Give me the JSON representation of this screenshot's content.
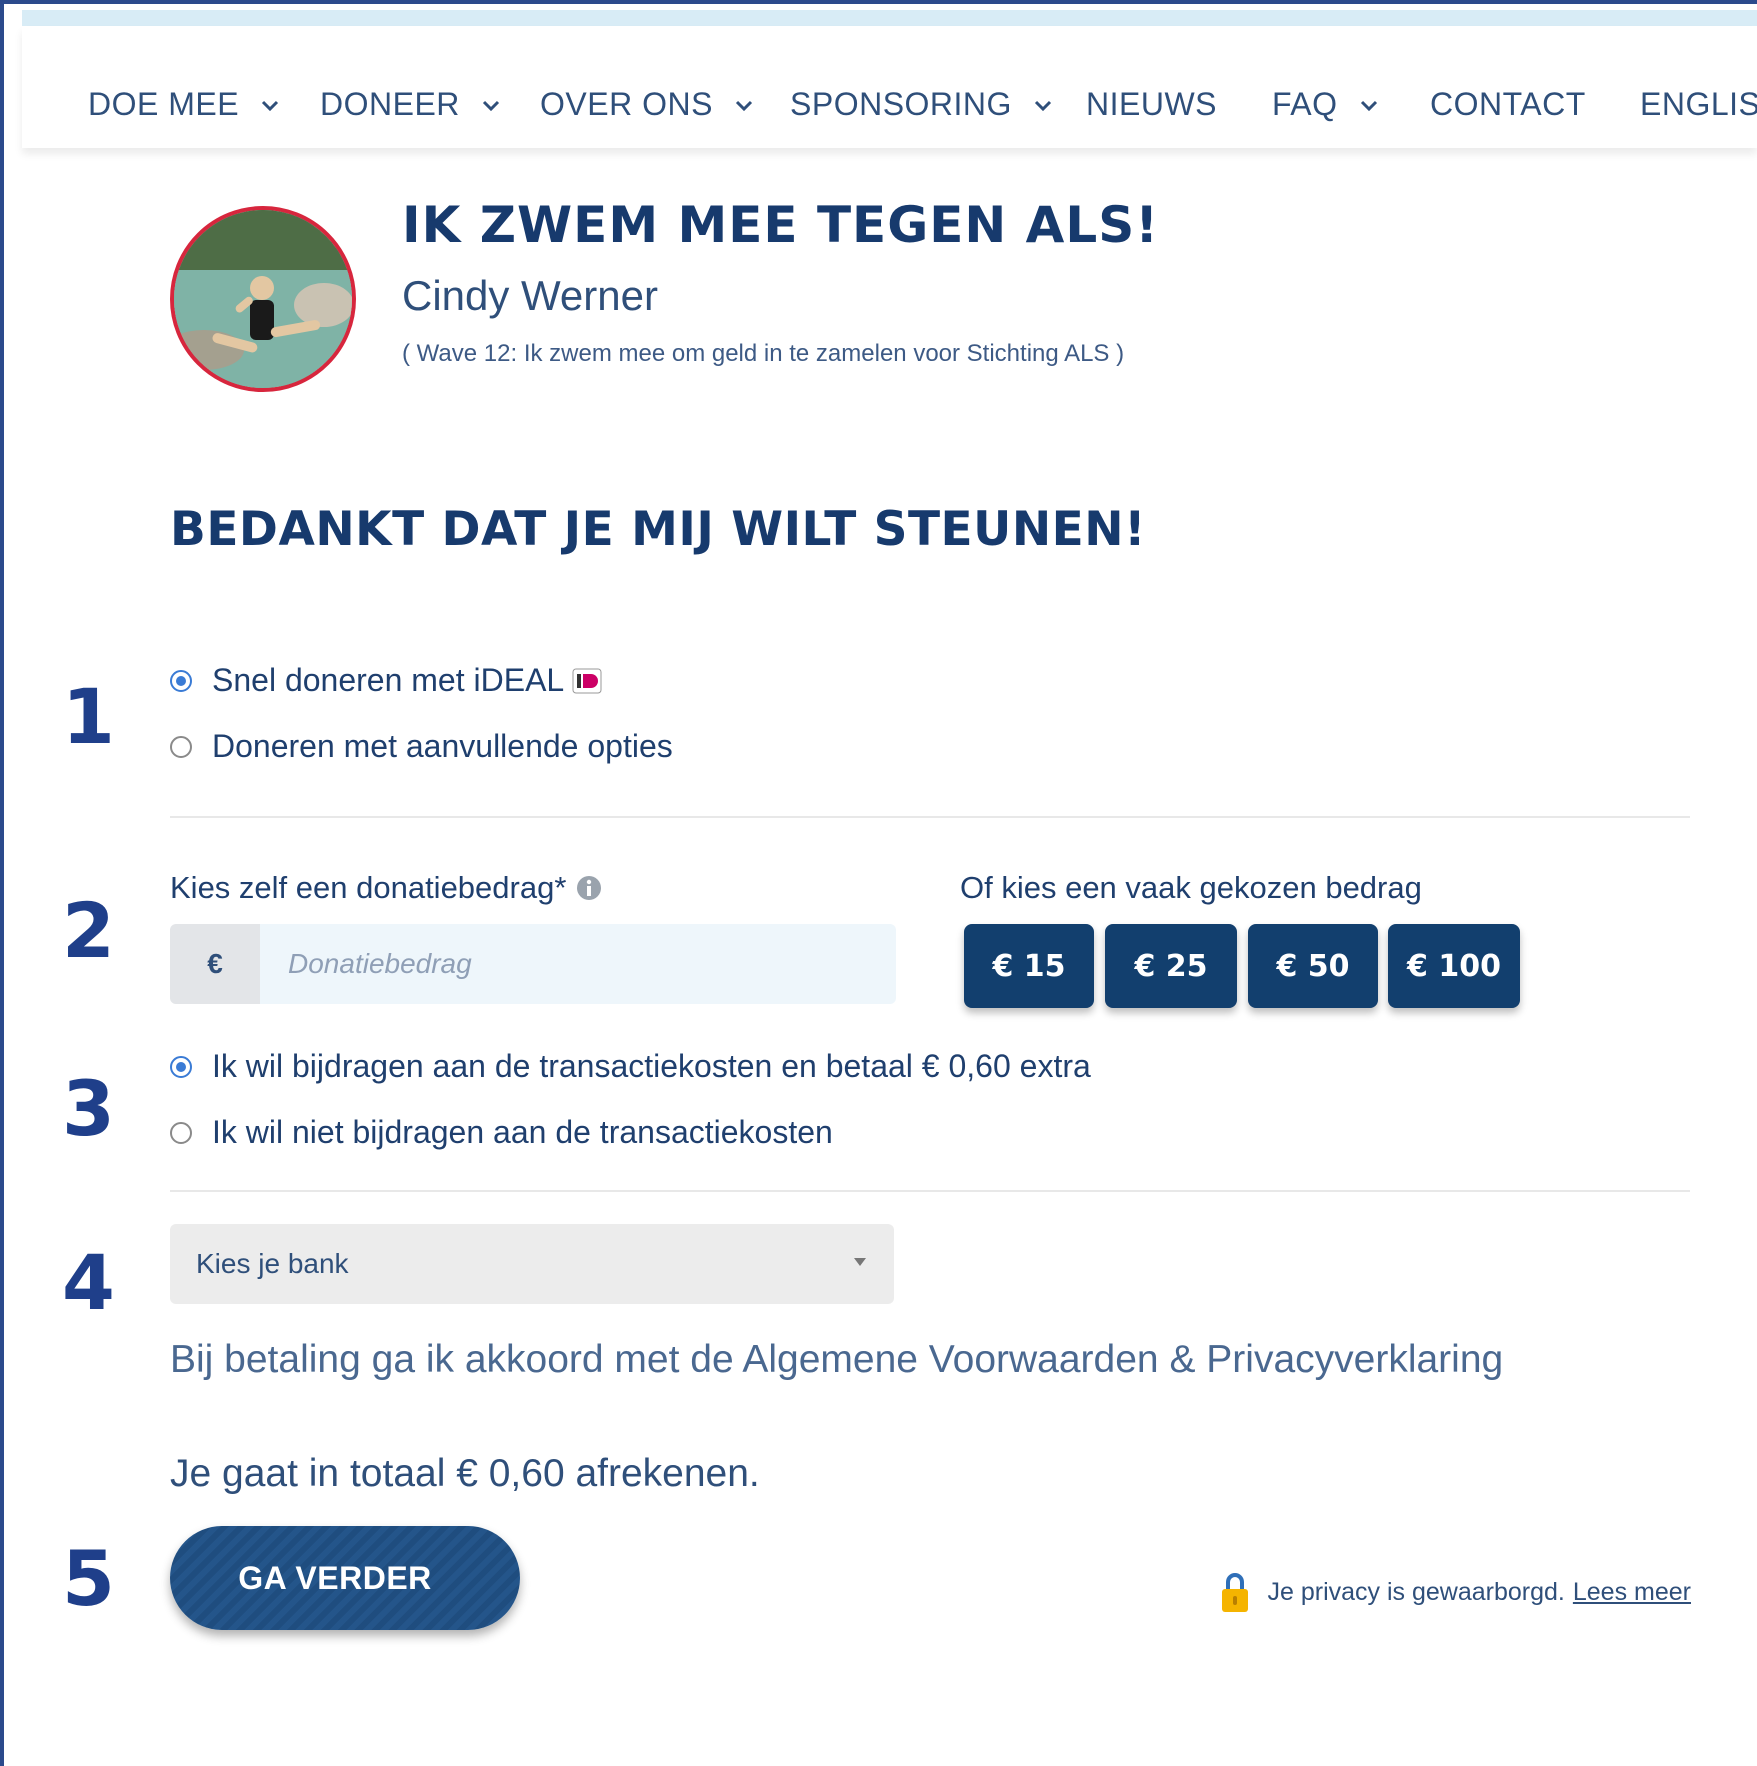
{
  "nav": {
    "items": [
      {
        "label": "DOE MEE",
        "has_dropdown": true
      },
      {
        "label": "DONEER",
        "has_dropdown": true
      },
      {
        "label": "OVER ONS",
        "has_dropdown": true
      },
      {
        "label": "SPONSORING",
        "has_dropdown": true
      },
      {
        "label": "NIEUWS",
        "has_dropdown": false
      },
      {
        "label": "FAQ",
        "has_dropdown": true
      },
      {
        "label": "CONTACT",
        "has_dropdown": false
      },
      {
        "label": "ENGLISH",
        "has_dropdown": false
      }
    ]
  },
  "profile": {
    "title": "IK ZWEM MEE TEGEN ALS!",
    "name": "Cindy Werner",
    "subtitle": "( Wave 12: Ik zwem mee om geld in te zamelen voor Stichting ALS )"
  },
  "heading": "BEDANKT DAT JE MIJ WILT STEUNEN!",
  "steps": [
    "1",
    "2",
    "3",
    "4",
    "5"
  ],
  "donation_type": {
    "options": [
      {
        "label": "Snel doneren met iDEAL",
        "checked": true
      },
      {
        "label": "Doneren met aanvullende opties",
        "checked": false
      }
    ]
  },
  "amount": {
    "label": "Kies zelf een donatiebedrag*",
    "currency": "€",
    "placeholder": "Donatiebedrag",
    "presets_label": "Of kies een vaak gekozen bedrag",
    "presets": [
      "€ 15",
      "€ 25",
      "€ 50",
      "€ 100"
    ]
  },
  "fees": {
    "options": [
      {
        "label": "Ik wil bijdragen aan de transactiekosten en betaal € 0,60 extra",
        "checked": true
      },
      {
        "label": "Ik wil niet bijdragen aan de transactiekosten",
        "checked": false
      }
    ]
  },
  "bank": {
    "selected": "Kies je bank"
  },
  "terms": "Bij betaling ga ik akkoord met de Algemene Voorwaarden & Privacyverklaring",
  "total": "Je gaat in totaal € 0,60 afrekenen.",
  "continue_label": "GA VERDER",
  "privacy": {
    "text": "Je privacy is gewaarborgd.",
    "link": "Lees meer"
  },
  "colors": {
    "primary": "#123f6e",
    "accent": "#d7263d",
    "radio": "#3a7bd5"
  }
}
